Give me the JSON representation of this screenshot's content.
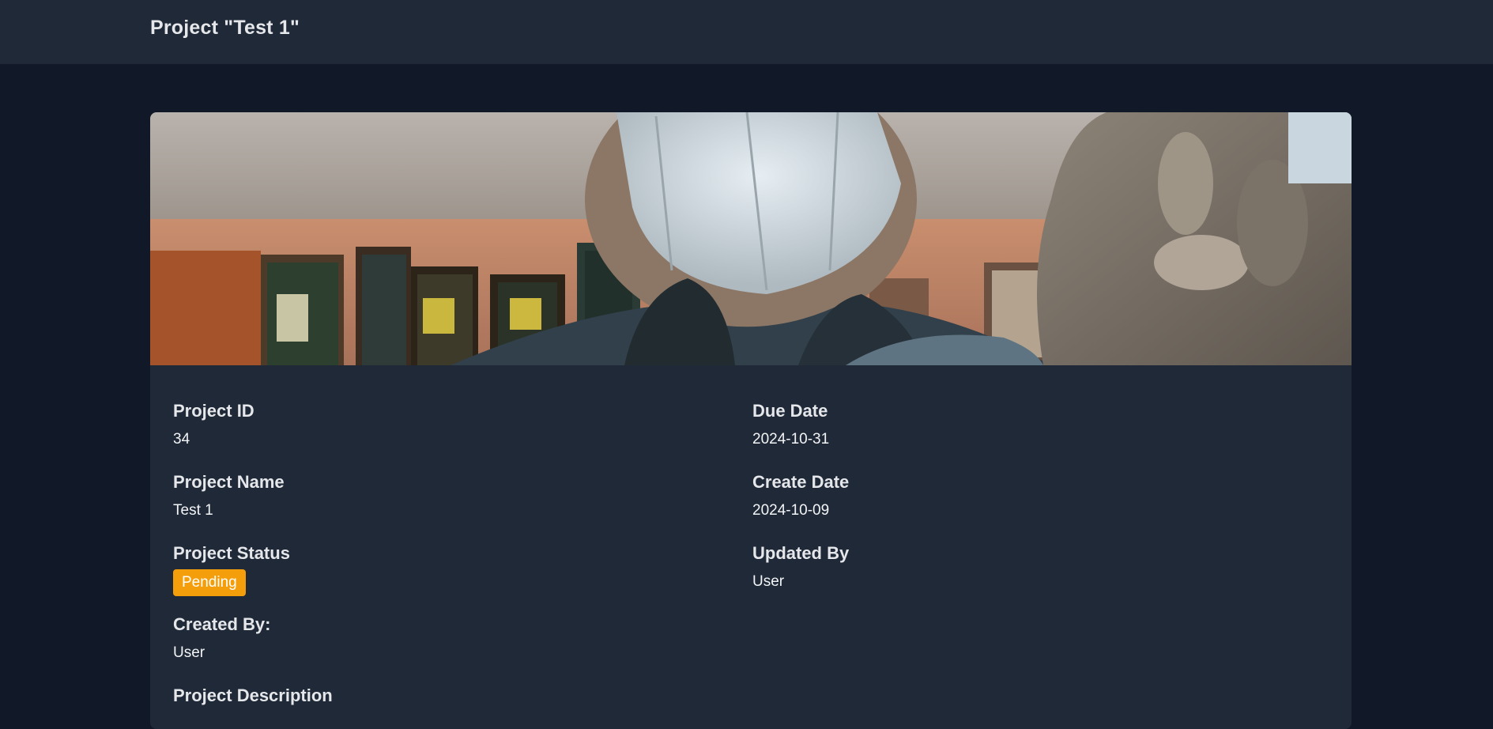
{
  "header": {
    "title": "Project \"Test 1\""
  },
  "project": {
    "left": [
      {
        "label": "Project ID",
        "value": "34"
      },
      {
        "label": "Project Name",
        "value": "Test 1"
      },
      {
        "label": "Project Status",
        "value": "Pending"
      },
      {
        "label": "Created By:",
        "value": "User"
      },
      {
        "label": "Project Description",
        "value": ""
      }
    ],
    "right": [
      {
        "label": "Due Date",
        "value": "2024-10-31"
      },
      {
        "label": "Create Date",
        "value": "2024-10-09"
      },
      {
        "label": "Updated By",
        "value": "User"
      }
    ],
    "status_color": "#f59e0b"
  },
  "colors": {
    "page_bg": "#111827",
    "panel_bg": "#1f2937",
    "text": "#e5e7eb"
  }
}
